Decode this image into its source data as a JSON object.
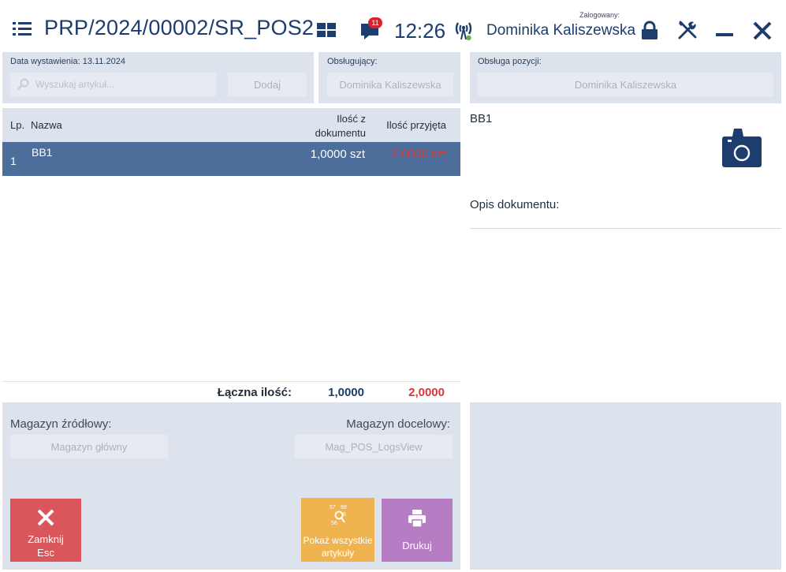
{
  "header": {
    "title": "PRP/2024/00002/SR_POS2",
    "notification_count": "11",
    "time": "12:26",
    "logged_label": "Zalogowany:",
    "user_name": "Dominika Kaliszewska"
  },
  "document": {
    "issue_date_label": "Data wystawienia: 13.11.2024",
    "search_placeholder": "Wyszukaj artykuł...",
    "add_button": "Dodaj",
    "handler_label": "Obsługujący:",
    "handler_value": "Dominika Kaliszewska"
  },
  "position_handler": {
    "label": "Obsługa pozycji:",
    "value": "Dominika Kaliszewska"
  },
  "table": {
    "headers": {
      "lp": "Lp.",
      "name": "Nazwa",
      "qty_doc_line1": "Ilość z",
      "qty_doc_line2": "dokumentu",
      "qty_received": "Ilość przyjęta"
    },
    "rows": [
      {
        "lp": "1",
        "name": "BB1",
        "qty_doc": "1,0000 szt",
        "qty_received": "2,0000 szt"
      }
    ]
  },
  "totals": {
    "label": "Łączna ilość:",
    "qty_doc": "1,0000",
    "qty_received": "2,0000"
  },
  "warehouses": {
    "source_label": "Magazyn źródłowy:",
    "source_value": "Magazyn główny",
    "target_label": "Magazyn docelowy:",
    "target_value": "Mag_POS_LogsView"
  },
  "actions": {
    "close_line1": "Zamknij",
    "close_line2": "Esc",
    "show_all_line1": "Pokaż wszystkie",
    "show_all_line2": "artykuły",
    "show_all_icon_nums": [
      "57",
      "98",
      "6",
      "56"
    ],
    "print": "Drukuj"
  },
  "detail": {
    "item_name": "BB1",
    "doc_description_label": "Opis dokumentu:"
  },
  "colors": {
    "accent": "#1c3d6e",
    "selected_row": "#4d6d9a",
    "received_red": "#d9383a",
    "close_tile": "#d9575a",
    "show_all_tile": "#efb44f",
    "print_tile": "#b77dc4",
    "panel_bg": "#dde3ec"
  },
  "icons": [
    "menu-icon",
    "grid-icon",
    "chat-icon",
    "antenna-icon",
    "lock-icon",
    "tools-icon",
    "minimize-icon",
    "close-icon",
    "search-icon",
    "camera-icon",
    "close-x-icon",
    "barcode-search-icon",
    "printer-icon"
  ]
}
